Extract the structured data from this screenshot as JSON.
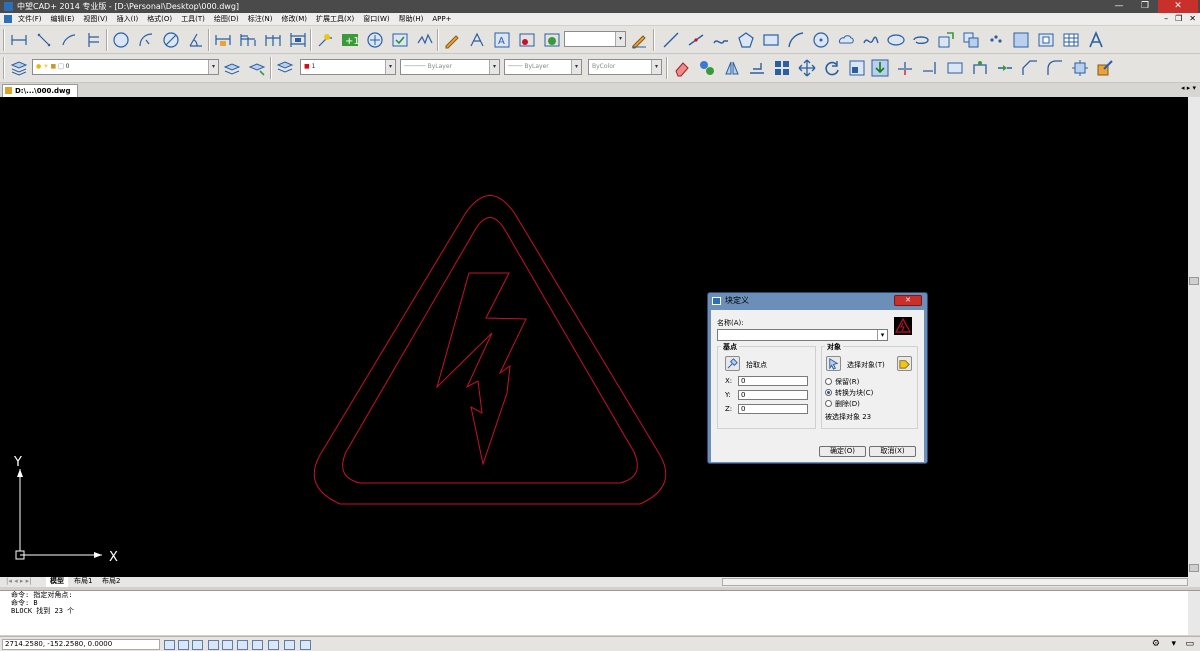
{
  "window": {
    "title": "中望CAD+ 2014 专业版 - [D:\\Personal\\Desktop\\000.dwg]",
    "minimize": "—",
    "maximize": "❐",
    "close": "✕"
  },
  "menu": {
    "items": [
      "文件(F)",
      "编辑(E)",
      "视图(V)",
      "插入(I)",
      "格式(O)",
      "工具(T)",
      "绘图(D)",
      "标注(N)",
      "修改(M)",
      "扩展工具(X)",
      "窗口(W)",
      "帮助(H)",
      "APP+"
    ],
    "mdi_min": "–",
    "mdi_restore": "❐",
    "mdi_close": "✕"
  },
  "toolbar2": {
    "layer_value": "0",
    "color_value": "1",
    "linetype_value": "ByLayer",
    "lineweight_value": "ByLayer",
    "plotstyle_value": "ByColor"
  },
  "doc_tab": {
    "label": "D:\\...\\000.dwg",
    "nav": "◂ ▸ ▾"
  },
  "axes": {
    "y_label": "Y",
    "x_label": "X"
  },
  "layout_tabs": [
    "模型",
    "布局1",
    "布局2"
  ],
  "layout_nav": "|◂ ◂ ▸ ▸|",
  "command_lines": [
    "命令: 指定对角点:",
    "命令: B",
    "BLOCK 找到 23 个"
  ],
  "status": {
    "coords": "2714.2580,  -152.2580,  0.0000"
  },
  "dialog": {
    "title": "块定义",
    "close": "✕",
    "name_label": "名称(A):",
    "name_value": "",
    "base_group": "基点",
    "pick_point": "拾取点",
    "x_label": "X:",
    "y_label": "Y:",
    "z_label": "Z:",
    "x_value": "0",
    "y_value": "0",
    "z_value": "0",
    "objects_group": "对象",
    "select_objects": "选择对象(T)",
    "retain": "保留(R)",
    "convert": "转换为块(C)",
    "delete": "删除(D)",
    "selected_count": "被选择对象 23",
    "ok": "确定(O)",
    "cancel": "取消(X)"
  },
  "colors": {
    "canvas": "#000000",
    "drawing_stroke": "#c8102e",
    "axis": "#ffffff",
    "dialog_frame": "#6b8fb8"
  }
}
